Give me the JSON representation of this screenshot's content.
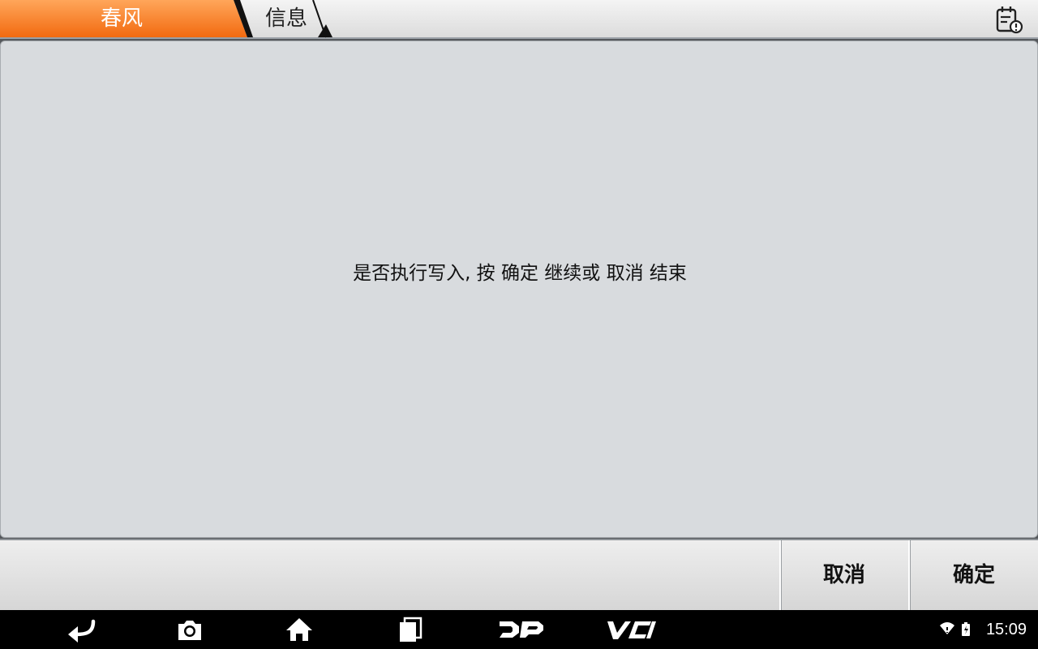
{
  "breadcrumb": {
    "items": [
      {
        "label": "春风"
      },
      {
        "label": "信息"
      }
    ]
  },
  "header": {
    "right_icon": "report-calendar-icon"
  },
  "dialog": {
    "message": "是否执行写入, 按 确定 继续或 取消 结束"
  },
  "actions": {
    "cancel_label": "取消",
    "confirm_label": "确定"
  },
  "navbar": {
    "icons": [
      "back-icon",
      "screenshot-camera-icon",
      "home-icon",
      "recent-apps-icon",
      "dp-logo-icon",
      "vci-icon"
    ]
  },
  "status_bar": {
    "time": "15:09",
    "icons": [
      "wifi-icon",
      "battery-icon"
    ]
  },
  "colors": {
    "accent": "#f47b20",
    "panel": "#d8dbde",
    "navbar": "#000000"
  }
}
